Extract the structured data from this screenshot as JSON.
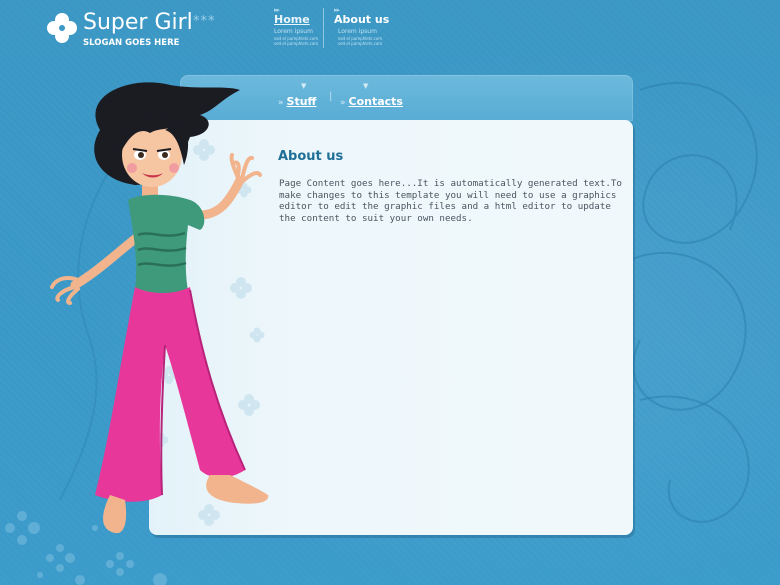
{
  "header": {
    "logo_title": "Super Girl",
    "logo_stars": "***",
    "slogan": "SLOGAN GOES HERE"
  },
  "topnav": [
    {
      "label": "Home",
      "sub": "Lorem ipsum",
      "tiny1": "sed el pamphlets.com",
      "tiny2": "sed el pamphlets.com"
    },
    {
      "label": "About us",
      "sub": "Lorem ipsum",
      "tiny1": "sed el pamphlets.com",
      "tiny2": "sed el pamphlets.com"
    }
  ],
  "subnav": [
    {
      "label": "Stuff"
    },
    {
      "label": "Contacts"
    }
  ],
  "subnav_separator": "|",
  "content": {
    "title": "About us",
    "body": "Page Content goes here...It is automatically generated text.To make changes to this template you will need to use a graphics editor to edit the graphic files and a html editor to update the content to suit your own needs."
  },
  "colors": {
    "background": "#3a98c6",
    "panel": "#f0f8fb",
    "title": "#1f6f96",
    "pants": "#e8379a",
    "shirt": "#3f9a7c"
  }
}
